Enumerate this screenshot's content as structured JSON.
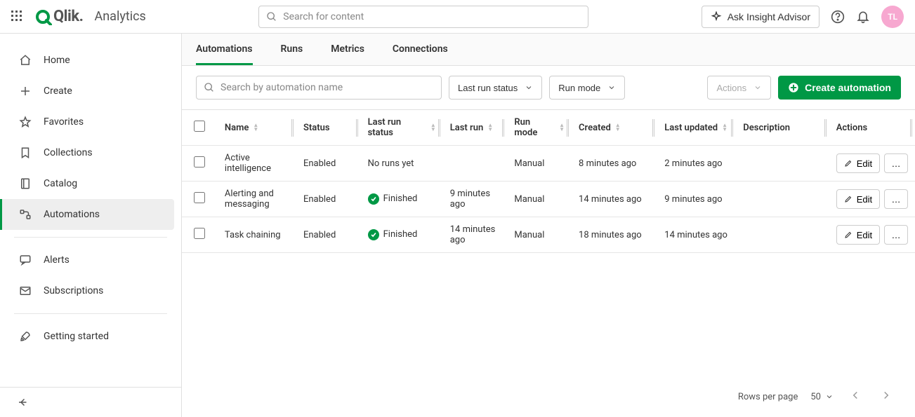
{
  "header": {
    "product": "Qlik",
    "section": "Analytics",
    "search_placeholder": "Search for content",
    "insight_label": "Ask Insight Advisor",
    "avatar_initials": "TL"
  },
  "sidebar": {
    "items": [
      {
        "label": "Home",
        "icon": "home"
      },
      {
        "label": "Create",
        "icon": "plus"
      },
      {
        "label": "Favorites",
        "icon": "star"
      },
      {
        "label": "Collections",
        "icon": "bookmark"
      },
      {
        "label": "Catalog",
        "icon": "book"
      },
      {
        "label": "Automations",
        "icon": "flow",
        "active": true
      },
      {
        "label": "Alerts",
        "icon": "chat"
      },
      {
        "label": "Subscriptions",
        "icon": "mail"
      },
      {
        "label": "Getting started",
        "icon": "rocket"
      }
    ]
  },
  "tabs": [
    "Automations",
    "Runs",
    "Metrics",
    "Connections"
  ],
  "active_tab": 0,
  "toolbar": {
    "search_placeholder": "Search by automation name",
    "last_run_label": "Last run status",
    "run_mode_label": "Run mode",
    "actions_label": "Actions",
    "create_label": "Create automation"
  },
  "columns": [
    "Name",
    "Status",
    "Last run status",
    "Last run",
    "Run mode",
    "Created",
    "Last updated",
    "Description",
    "Actions"
  ],
  "edit_label": "Edit",
  "rows": [
    {
      "name": "Active intelligence",
      "status": "Enabled",
      "last_run_status": "No runs yet",
      "last_run": "",
      "run_mode": "Manual",
      "created": "8 minutes ago",
      "updated": "2 minutes ago",
      "description": ""
    },
    {
      "name": "Alerting and messaging",
      "status": "Enabled",
      "last_run_status": "Finished",
      "last_run": "9 minutes ago",
      "run_mode": "Manual",
      "created": "14 minutes ago",
      "updated": "9 minutes ago",
      "description": ""
    },
    {
      "name": "Task chaining",
      "status": "Enabled",
      "last_run_status": "Finished",
      "last_run": "14 minutes ago",
      "run_mode": "Manual",
      "created": "18 minutes ago",
      "updated": "14 minutes ago",
      "description": ""
    }
  ],
  "pager": {
    "rows_label": "Rows per page",
    "rows_value": "50"
  }
}
